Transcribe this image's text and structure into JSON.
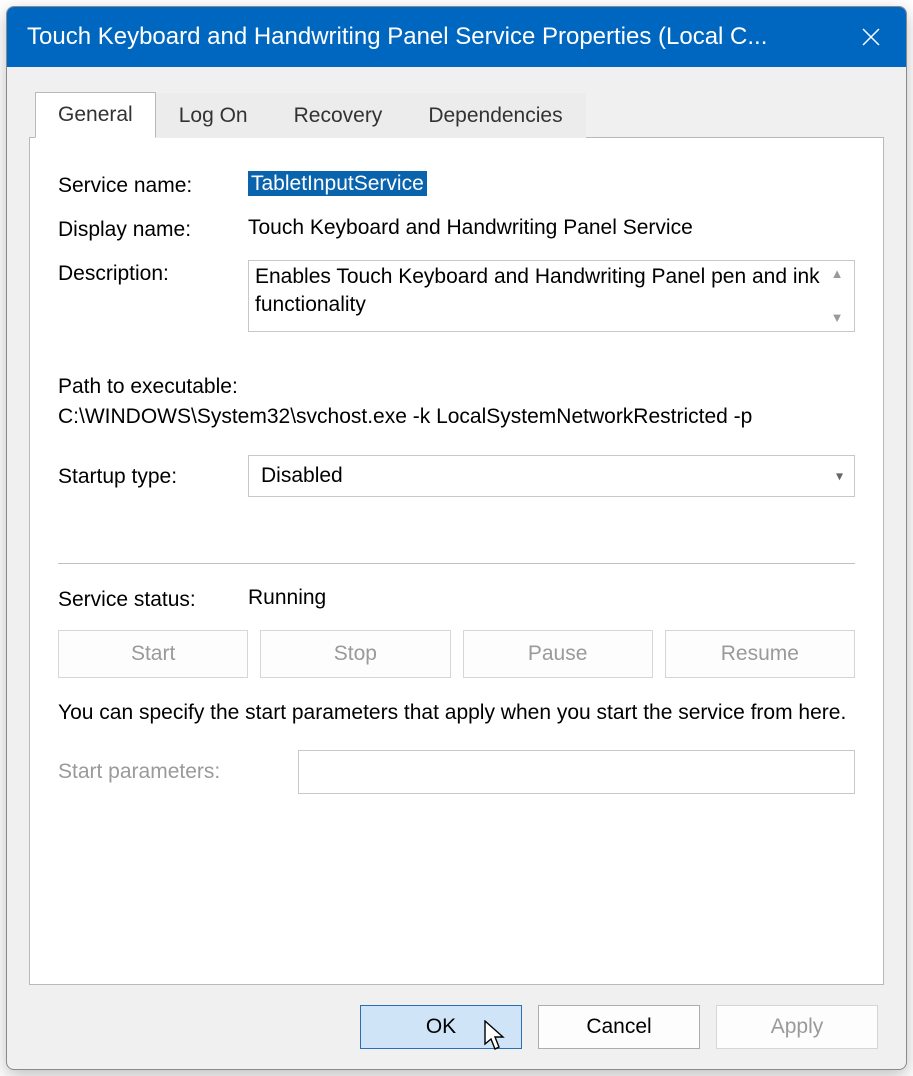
{
  "window": {
    "title": "Touch Keyboard and Handwriting Panel Service Properties (Local C..."
  },
  "tabs": {
    "general": "General",
    "logon": "Log On",
    "recovery": "Recovery",
    "dependencies": "Dependencies",
    "active": "general"
  },
  "labels": {
    "service_name": "Service name:",
    "display_name": "Display name:",
    "description": "Description:",
    "path_to_exe": "Path to executable:",
    "startup_type": "Startup type:",
    "service_status": "Service status:",
    "start_parameters": "Start parameters:"
  },
  "values": {
    "service_name": "TabletInputService",
    "display_name": "Touch Keyboard and Handwriting Panel Service",
    "description": "Enables Touch Keyboard and Handwriting Panel pen and ink functionality",
    "path": "C:\\WINDOWS\\System32\\svchost.exe -k LocalSystemNetworkRestricted -p",
    "startup_type": "Disabled",
    "service_status": "Running",
    "start_parameters": ""
  },
  "service_buttons": {
    "start": "Start",
    "stop": "Stop",
    "pause": "Pause",
    "resume": "Resume"
  },
  "hint": "You can specify the start parameters that apply when you start the service from here.",
  "dialog_buttons": {
    "ok": "OK",
    "cancel": "Cancel",
    "apply": "Apply"
  }
}
